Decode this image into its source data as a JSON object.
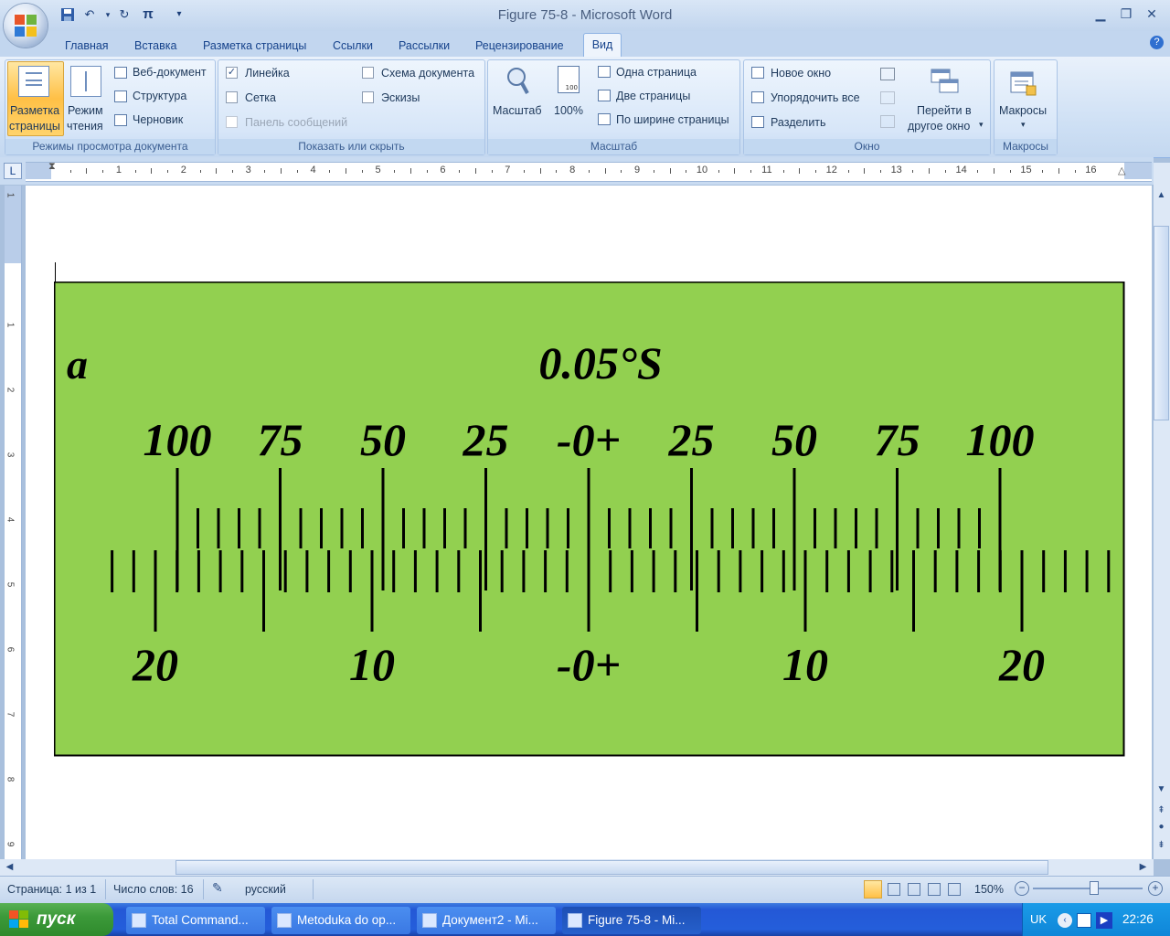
{
  "window": {
    "title": "Figure 75-8 - Microsoft Word"
  },
  "qat": {
    "save_icon": "save-icon",
    "undo_icon": "undo-icon",
    "redo_icon": "redo-icon",
    "pi_label": "π",
    "more_icon": "▾"
  },
  "tabs": [
    {
      "label": "Главная"
    },
    {
      "label": "Вставка"
    },
    {
      "label": "Разметка страницы"
    },
    {
      "label": "Ссылки"
    },
    {
      "label": "Рассылки"
    },
    {
      "label": "Рецензирование"
    },
    {
      "label": "Вид"
    }
  ],
  "ribbon": {
    "views": {
      "label": "Режимы просмотра документа",
      "print_layout_1": "Разметка",
      "print_layout_2": "страницы",
      "reading_1": "Режим",
      "reading_2": "чтения",
      "web": "Веб-документ",
      "outline": "Структура",
      "draft": "Черновик"
    },
    "show_hide": {
      "label": "Показать или скрыть",
      "ruler": "Линейка",
      "ruler_checked": true,
      "grid": "Сетка",
      "message_bar": "Панель сообщений",
      "doc_map": "Схема документа",
      "thumbnails": "Эскизы"
    },
    "zoom": {
      "label": "Масштаб",
      "zoom": "Масштаб",
      "hundred": "100%",
      "one_page": "Одна страница",
      "two_pages": "Две страницы",
      "page_width": "По ширине страницы"
    },
    "window": {
      "label": "Окно",
      "new_window": "Новое окно",
      "arrange_all": "Упорядочить все",
      "split": "Разделить",
      "switch_1": "Перейти в",
      "switch_2": "другое окно"
    },
    "macros": {
      "label": "Макросы",
      "macros": "Макросы"
    }
  },
  "ruler": {
    "h_numbers": [
      "1",
      "2",
      "3",
      "4",
      "5",
      "6",
      "7",
      "8",
      "9",
      "10",
      "11",
      "12",
      "13",
      "14",
      "15",
      "16"
    ],
    "v_numbers": [
      "1",
      "1",
      "2",
      "3",
      "4",
      "5",
      "6",
      "7",
      "8",
      "9"
    ],
    "corner": "L"
  },
  "figure": {
    "background": "#92d050",
    "title_letter": "a",
    "title": "0.05°S",
    "upper_labels": [
      "100",
      "75",
      "50",
      "25",
      "-0+",
      "25",
      "50",
      "75",
      "100"
    ],
    "lower_labels": [
      "20",
      "10",
      "-0+",
      "10",
      "20"
    ]
  },
  "status": {
    "page": "Страница: 1 из 1",
    "words": "Число слов: 16",
    "language": "русский",
    "zoom": "150%"
  },
  "taskbar": {
    "start": "пуск",
    "tasks": [
      {
        "label": "Total Command..."
      },
      {
        "label": "Metoduka do op..."
      },
      {
        "label": "Документ2 - Mi..."
      },
      {
        "label": "Figure 75-8 - Mi..."
      }
    ],
    "lang": "UK",
    "time": "22:26"
  }
}
